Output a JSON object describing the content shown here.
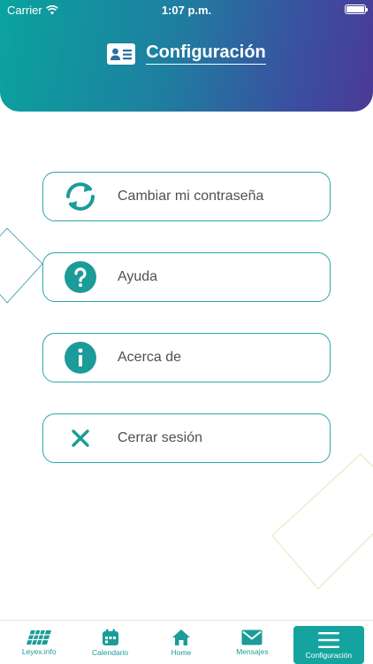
{
  "status_bar": {
    "carrier": "Carrier",
    "time": "1:07 p.m."
  },
  "header": {
    "title": "Configuración",
    "icon": "id-card-icon"
  },
  "menu": [
    {
      "id": "change-password",
      "label": "Cambiar mi contraseña",
      "icon": "refresh-icon"
    },
    {
      "id": "help",
      "label": "Ayuda",
      "icon": "question-icon"
    },
    {
      "id": "about",
      "label": "Acerca de",
      "icon": "info-icon"
    },
    {
      "id": "logout",
      "label": "Cerrar sesión",
      "icon": "close-icon"
    }
  ],
  "tabs": [
    {
      "label": "Leyex.info",
      "icon": "solar-panel-icon",
      "active": false
    },
    {
      "label": "Calendario",
      "icon": "calendar-icon",
      "active": false
    },
    {
      "label": "Home",
      "icon": "home-icon",
      "active": false
    },
    {
      "label": "Mensajes",
      "icon": "mail-icon",
      "active": false
    },
    {
      "label": "Configuración",
      "icon": "menu-icon",
      "active": true
    }
  ],
  "colors": {
    "accent": "#1b9c98",
    "gradient_start": "#0aa39e",
    "gradient_end": "#4b3a96"
  }
}
